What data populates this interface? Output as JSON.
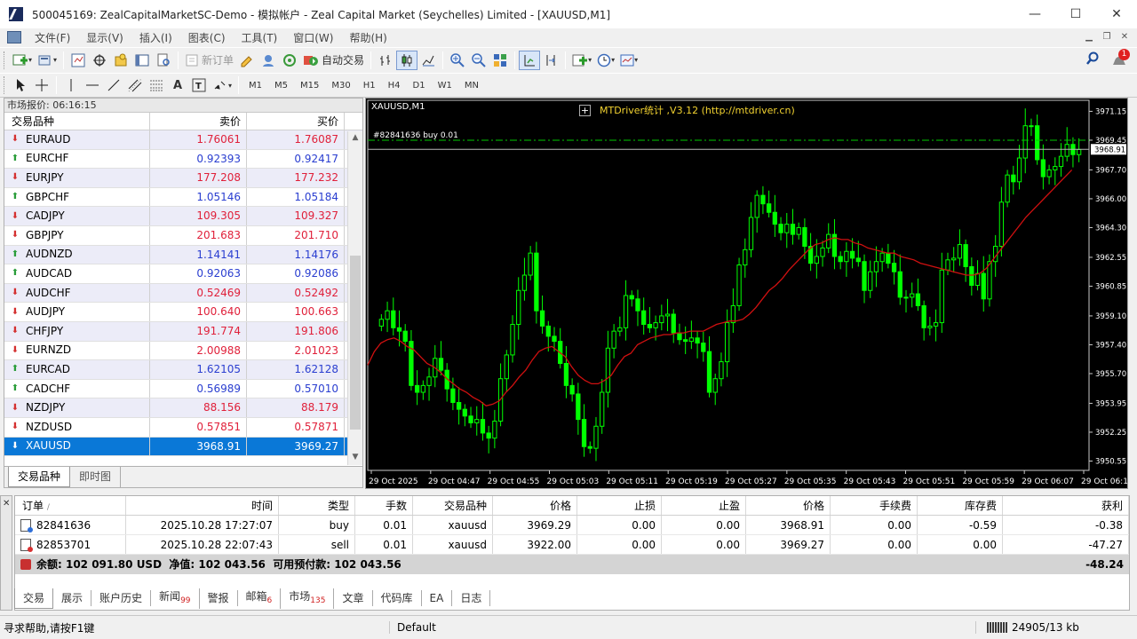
{
  "window": {
    "title": "500045169: ZealCapitalMarketSC-Demo - 模拟帐户 - Zeal Capital Market (Seychelles) Limited - [XAUUSD,M1]",
    "minimize": "—",
    "maximize": "☐",
    "close": "✕"
  },
  "menu": [
    "文件(F)",
    "显示(V)",
    "插入(I)",
    "图表(C)",
    "工具(T)",
    "窗口(W)",
    "帮助(H)"
  ],
  "toolbar": {
    "new_order": "新订单",
    "auto_trade": "自动交易",
    "timeframes": [
      "M1",
      "M5",
      "M15",
      "M30",
      "H1",
      "H4",
      "D1",
      "W1",
      "MN"
    ]
  },
  "market_watch": {
    "title": "市场报价: 06:16:15",
    "col_symbol": "交易品种",
    "col_bid": "卖价",
    "col_ask": "买价",
    "rows": [
      {
        "symbol": "EURAUD",
        "bid": "1.76061",
        "ask": "1.76087",
        "dir": "down"
      },
      {
        "symbol": "EURCHF",
        "bid": "0.92393",
        "ask": "0.92417",
        "dir": "up"
      },
      {
        "symbol": "EURJPY",
        "bid": "177.208",
        "ask": "177.232",
        "dir": "down"
      },
      {
        "symbol": "GBPCHF",
        "bid": "1.05146",
        "ask": "1.05184",
        "dir": "up"
      },
      {
        "symbol": "CADJPY",
        "bid": "109.305",
        "ask": "109.327",
        "dir": "down"
      },
      {
        "symbol": "GBPJPY",
        "bid": "201.683",
        "ask": "201.710",
        "dir": "down"
      },
      {
        "symbol": "AUDNZD",
        "bid": "1.14141",
        "ask": "1.14176",
        "dir": "up"
      },
      {
        "symbol": "AUDCAD",
        "bid": "0.92063",
        "ask": "0.92086",
        "dir": "up"
      },
      {
        "symbol": "AUDCHF",
        "bid": "0.52469",
        "ask": "0.52492",
        "dir": "down"
      },
      {
        "symbol": "AUDJPY",
        "bid": "100.640",
        "ask": "100.663",
        "dir": "down"
      },
      {
        "symbol": "CHFJPY",
        "bid": "191.774",
        "ask": "191.806",
        "dir": "down"
      },
      {
        "symbol": "EURNZD",
        "bid": "2.00988",
        "ask": "2.01023",
        "dir": "down"
      },
      {
        "symbol": "EURCAD",
        "bid": "1.62105",
        "ask": "1.62128",
        "dir": "up"
      },
      {
        "symbol": "CADCHF",
        "bid": "0.56989",
        "ask": "0.57010",
        "dir": "up"
      },
      {
        "symbol": "NZDJPY",
        "bid": "88.156",
        "ask": "88.179",
        "dir": "down"
      },
      {
        "symbol": "NZDUSD",
        "bid": "0.57851",
        "ask": "0.57871",
        "dir": "down"
      },
      {
        "symbol": "XAUUSD",
        "bid": "3968.91",
        "ask": "3969.27",
        "dir": "down",
        "selected": true
      }
    ],
    "tabs": [
      "交易品种",
      "即时图"
    ]
  },
  "chart": {
    "title": "XAUUSD,M1",
    "indicator_label": "MTDriver统计 ,V3.12 (http://mtdriver.cn)",
    "order_label": "#82841636 buy 0.01",
    "current_price_tag": "3968.91",
    "order_price_tag": "3969.45",
    "y_ticks": [
      "3971.15",
      "3969.45",
      "3967.70",
      "3966.00",
      "3964.30",
      "3962.55",
      "3960.85",
      "3959.10",
      "3957.40",
      "3955.70",
      "3953.95",
      "3952.25",
      "3950.55"
    ],
    "x_ticks": [
      "29 Oct 2025",
      "29 Oct 04:47",
      "29 Oct 04:55",
      "29 Oct 05:03",
      "29 Oct 05:11",
      "29 Oct 05:19",
      "29 Oct 05:27",
      "29 Oct 05:35",
      "29 Oct 05:43",
      "29 Oct 05:51",
      "29 Oct 05:59",
      "29 Oct 06:07",
      "29 Oct 06:15"
    ],
    "colors": {
      "background": "#000000",
      "candle": "#00ff00",
      "ma": "#d01010",
      "order_line": "#00c800"
    }
  },
  "chart_data": {
    "type": "candlestick",
    "title": "XAUUSD,M1",
    "ylim": [
      3950.0,
      3971.8
    ],
    "y_axis_position": "right",
    "grid": false,
    "close_series": [
      3958.9,
      3959.4,
      3958.4,
      3958.2,
      3957.6,
      3955.0,
      3954.6,
      3955.0,
      3955.5,
      3956.6,
      3955.9,
      3954.8,
      3954.0,
      3953.6,
      3953.2,
      3952.8,
      3953.0,
      3952.2,
      3951.9,
      3952.9,
      3955.4,
      3956.8,
      3958.6,
      3960.6,
      3961.5,
      3962.8,
      3959.4,
      3958.5,
      3957.9,
      3957.6,
      3956.3,
      3955.0,
      3954.5,
      3953.0,
      3951.4,
      3951.3,
      3952.6,
      3954.6,
      3957.2,
      3958.2,
      3958.4,
      3960.3,
      3960.1,
      3959.4,
      3958.6,
      3958.4,
      3958.7,
      3959.1,
      3959.2,
      3958.1,
      3957.7,
      3957.6,
      3957.8,
      3957.5,
      3957.0,
      3954.6,
      3955.4,
      3956.4,
      3958.7,
      3959.7,
      3962.1,
      3963.0,
      3964.9,
      3966.2,
      3965.7,
      3965.2,
      3964.5,
      3964.0,
      3964.5,
      3963.9,
      3964.3,
      3963.2,
      3962.2,
      3962.6,
      3963.1,
      3963.9,
      3962.6,
      3962.3,
      3962.9,
      3962.5,
      3962.3,
      3960.6,
      3961.7,
      3962.3,
      3962.8,
      3962.2,
      3961.7,
      3960.2,
      3960.2,
      3960.4,
      3959.7,
      3958.4,
      3958.5,
      3958.7,
      3961.8,
      3962.4,
      3962.5,
      3963.3,
      3962.0,
      3960.9,
      3961.6,
      3960.1,
      3962.3,
      3963.2,
      3965.8,
      3967.4,
      3967.0,
      3968.4,
      3970.3,
      3970.3,
      3968.3,
      3967.3,
      3967.7,
      3967.9,
      3968.5,
      3969.2,
      3968.6,
      3968.9
    ],
    "ma_series": [
      3956.2,
      3957.0,
      3957.5,
      3957.7,
      3957.8,
      3957.6,
      3957.3,
      3957.1,
      3956.7,
      3956.3,
      3956.1,
      3955.8,
      3955.4,
      3955.1,
      3954.8,
      3954.6,
      3954.3,
      3954.1,
      3953.8,
      3953.9,
      3954.1,
      3954.6,
      3955.0,
      3955.5,
      3955.9,
      3956.5,
      3957.0,
      3957.2,
      3957.3,
      3957.0,
      3956.7,
      3956.1,
      3955.6,
      3955.3,
      3955.1,
      3955.1,
      3955.3,
      3955.6,
      3956.2,
      3956.7,
      3956.9,
      3957.4,
      3957.6,
      3957.8,
      3957.9,
      3958.0,
      3958.0,
      3958.1,
      3958.1,
      3958.2,
      3958.2,
      3958.2,
      3958.4,
      3958.6,
      3958.7,
      3958.8,
      3958.8,
      3958.9,
      3959.2,
      3959.6,
      3960.1,
      3960.6,
      3960.9,
      3961.3,
      3961.8,
      3962.2,
      3962.6,
      3963.0,
      3963.3,
      3963.4,
      3963.6,
      3963.7,
      3963.6,
      3963.6,
      3963.4,
      3963.3,
      3963.1,
      3963.0,
      3962.9,
      3962.8,
      3962.8,
      3962.6,
      3962.5,
      3962.4,
      3962.2,
      3962.1,
      3962.0,
      3961.9,
      3961.8,
      3961.7,
      3961.6,
      3961.5,
      3961.5,
      3961.6,
      3961.9,
      3962.4,
      3962.9,
      3963.4,
      3963.9,
      3964.4,
      3964.9,
      3965.3,
      3965.7,
      3966.1,
      3966.5,
      3966.9,
      3967.3,
      3967.7
    ]
  },
  "terminal": {
    "columns": {
      "order": "订单",
      "time": "时间",
      "type": "类型",
      "size": "手数",
      "symbol": "交易品种",
      "price": "价格",
      "sl": "止损",
      "tp": "止盈",
      "cur_price": "价格",
      "commission": "手续费",
      "swap": "库存费",
      "profit": "获利"
    },
    "orders": [
      {
        "order": "82841636",
        "time": "2025.10.28 17:27:07",
        "type": "buy",
        "size": "0.01",
        "symbol": "xauusd",
        "price": "3969.29",
        "sl": "0.00",
        "tp": "0.00",
        "cur_price": "3968.91",
        "commission": "0.00",
        "swap": "-0.59",
        "profit": "-0.38"
      },
      {
        "order": "82853701",
        "time": "2025.10.28 22:07:43",
        "type": "sell",
        "size": "0.01",
        "symbol": "xauusd",
        "price": "3922.00",
        "sl": "0.00",
        "tp": "0.00",
        "cur_price": "3969.27",
        "commission": "0.00",
        "swap": "0.00",
        "profit": "-47.27"
      }
    ],
    "balance_line": "余额: 102 091.80 USD  净值: 102 043.56  可用预付款: 102 043.56",
    "total_profit": "-48.24",
    "tabs": [
      {
        "label": "交易",
        "badge": ""
      },
      {
        "label": "展示",
        "badge": ""
      },
      {
        "label": "账户历史",
        "badge": ""
      },
      {
        "label": "新闻",
        "badge": "99"
      },
      {
        "label": "警报",
        "badge": ""
      },
      {
        "label": "邮箱",
        "badge": "6"
      },
      {
        "label": "市场",
        "badge": "135"
      },
      {
        "label": "文章",
        "badge": ""
      },
      {
        "label": "代码库",
        "badge": ""
      },
      {
        "label": "EA",
        "badge": ""
      },
      {
        "label": "日志",
        "badge": ""
      }
    ]
  },
  "status": {
    "help": "寻求帮助,请按F1键",
    "profile": "Default",
    "connection": "24905/13 kb"
  }
}
